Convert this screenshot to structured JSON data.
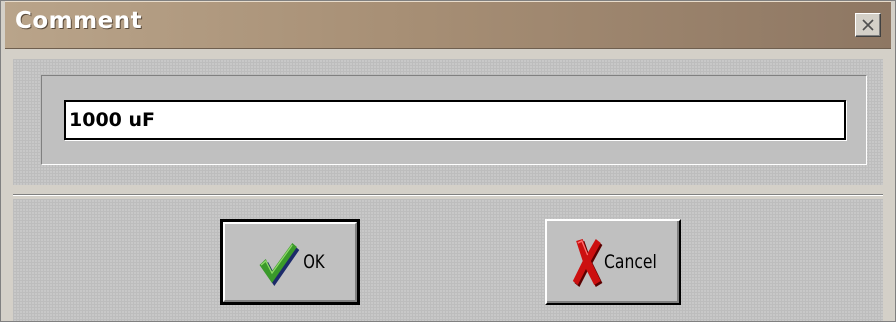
{
  "window": {
    "title": "Comment"
  },
  "comment": {
    "value": "1000 uF"
  },
  "buttons": {
    "ok_label": "OK",
    "cancel_label": "Cancel"
  },
  "icons": {
    "close": "close-icon",
    "ok": "checkmark-icon",
    "cancel": "red-x-icon"
  },
  "colors": {
    "titlebar": "#a78f75",
    "checkmark_green": "#3a9a2a",
    "checkmark_shadow": "#1c2a6a",
    "cancel_red": "#cc1010"
  }
}
